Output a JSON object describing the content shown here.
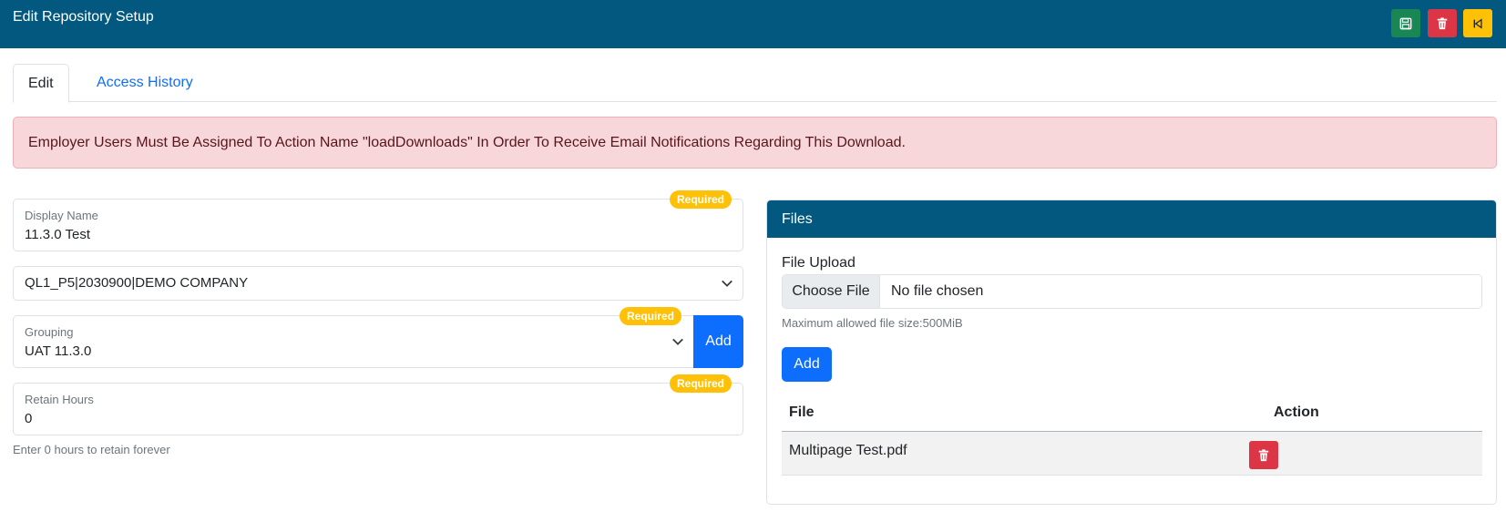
{
  "header": {
    "title": "Edit Repository Setup",
    "save_icon": "floppy-disk-icon",
    "delete_icon": "trash-icon",
    "back_icon": "step-back-icon",
    "colors": {
      "bar": "#02587e",
      "save": "#198754",
      "delete": "#dc3545",
      "back": "#ffc107"
    }
  },
  "tabs": [
    {
      "label": "Edit",
      "active": true
    },
    {
      "label": "Access History",
      "active": false
    }
  ],
  "alert": {
    "text": "Employer Users Must Be Assigned To Action Name \"loadDownloads\" In Order To Receive Email Notifications Regarding This Download."
  },
  "form": {
    "display_name": {
      "label": "Display Name",
      "value": "11.3.0 Test",
      "badge": "Required"
    },
    "company": {
      "value": "QL1_P5|2030900|DEMO COMPANY"
    },
    "grouping": {
      "label": "Grouping",
      "value": "UAT 11.3.0",
      "badge": "Required",
      "add_label": "Add"
    },
    "retain_hours": {
      "label": "Retain Hours",
      "value": "0",
      "badge": "Required",
      "hint": "Enter 0 hours to retain forever"
    }
  },
  "files": {
    "title": "Files",
    "upload_label": "File Upload",
    "choose_label": "Choose File",
    "file_status": "No file chosen",
    "max_size": "Maximum allowed file size:500MiB",
    "add_label": "Add",
    "table": {
      "headers": [
        "File",
        "Action"
      ],
      "rows": [
        {
          "file": "Multipage Test.pdf",
          "action_icon": "trash-icon"
        }
      ]
    }
  }
}
